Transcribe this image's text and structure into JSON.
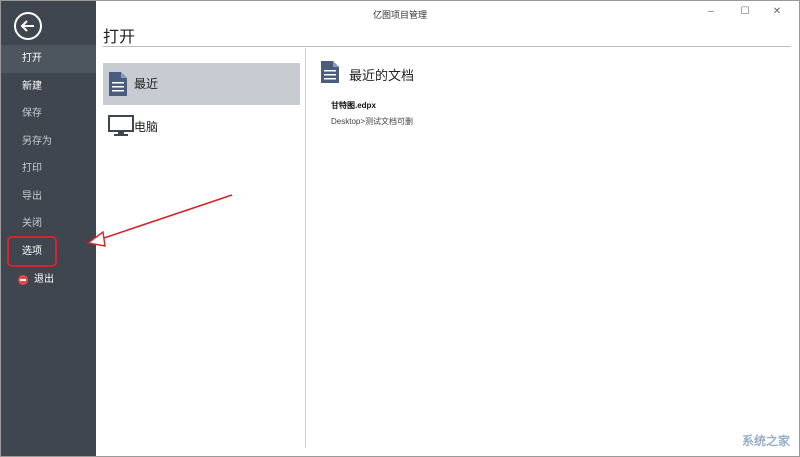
{
  "window": {
    "title": "亿图项目管理",
    "minimize": "–",
    "maximize": "☐",
    "close": "✕"
  },
  "sidebar": {
    "items": [
      {
        "label": "打开"
      },
      {
        "label": "新建"
      },
      {
        "label": "保存"
      },
      {
        "label": "另存为"
      },
      {
        "label": "打印"
      },
      {
        "label": "导出"
      },
      {
        "label": "关闭"
      },
      {
        "label": "选项"
      },
      {
        "label": "退出"
      }
    ]
  },
  "page": {
    "title": "打开"
  },
  "sources": [
    {
      "label": "最近",
      "icon": "document-icon"
    },
    {
      "label": "电脑",
      "icon": "monitor-icon"
    }
  ],
  "recent": {
    "heading": "最近的文档",
    "files": [
      {
        "name": "甘特图.edpx",
        "path": "Desktop>测试文档可删"
      }
    ]
  },
  "watermark": "系统之家"
}
